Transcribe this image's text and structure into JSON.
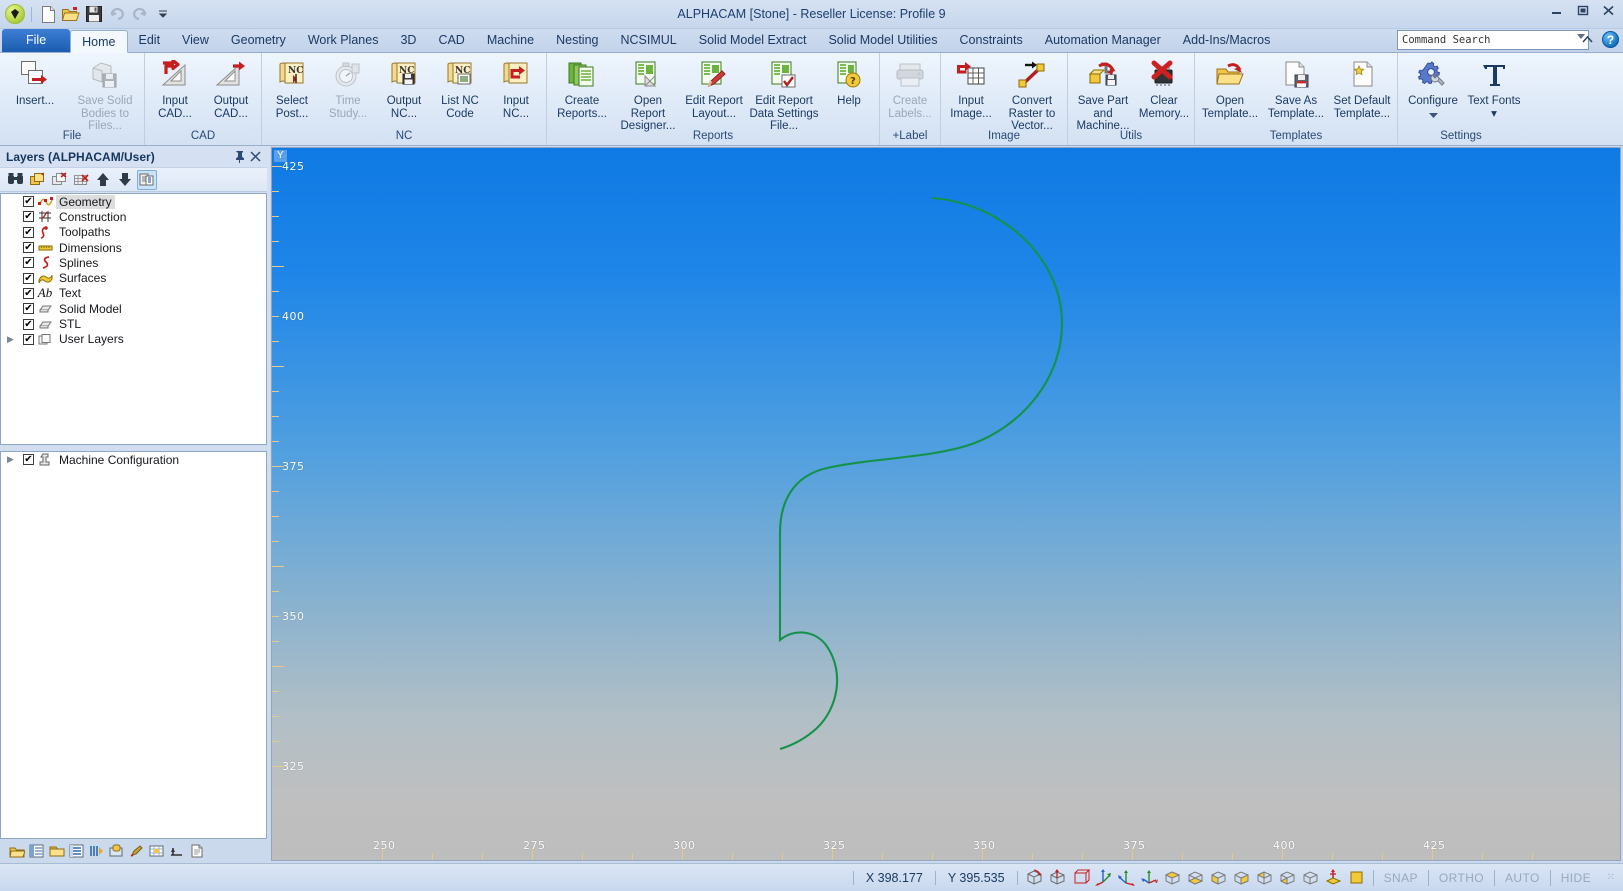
{
  "window": {
    "title": "ALPHACAM [Stone] - Reseller License: Profile 9",
    "minimize": "–",
    "maximize": "□",
    "close": "✕"
  },
  "quick_access": [
    {
      "name": "app-orb",
      "label": "ALPHACAM"
    },
    {
      "name": "new-file-icon",
      "label": "New"
    },
    {
      "name": "open-file-icon",
      "label": "Open"
    },
    {
      "name": "save-icon",
      "label": "Save"
    },
    {
      "name": "undo-icon",
      "label": "Undo"
    },
    {
      "name": "redo-icon",
      "label": "Redo"
    },
    {
      "name": "customize-qat-icon",
      "label": "Customize Quick Access Toolbar"
    }
  ],
  "tabs": [
    {
      "label": "File",
      "active": false,
      "kind": "file"
    },
    {
      "label": "Home",
      "active": true
    },
    {
      "label": "Edit",
      "active": false
    },
    {
      "label": "View",
      "active": false
    },
    {
      "label": "Geometry",
      "active": false
    },
    {
      "label": "Work Planes",
      "active": false
    },
    {
      "label": "3D",
      "active": false
    },
    {
      "label": "CAD",
      "active": false
    },
    {
      "label": "Machine",
      "active": false
    },
    {
      "label": "Nesting",
      "active": false
    },
    {
      "label": "NCSIMUL",
      "active": false
    },
    {
      "label": "Solid Model Extract",
      "active": false
    },
    {
      "label": "Solid Model Utilities",
      "active": false
    },
    {
      "label": "Constraints",
      "active": false
    },
    {
      "label": "Automation Manager",
      "active": false
    },
    {
      "label": "Add-Ins/Macros",
      "active": false
    }
  ],
  "command_search": {
    "placeholder": "Command Search",
    "value": "Command Search"
  },
  "ribbon": {
    "groups": [
      {
        "title": "File",
        "items": [
          {
            "label": "Insert...",
            "icon": "insert-icon",
            "disabled": false,
            "width": "w66"
          },
          {
            "label": "Save Solid Bodies to Files...",
            "icon": "save-solid-bodies-icon",
            "disabled": true,
            "width": "wide"
          }
        ]
      },
      {
        "title": "CAD",
        "items": [
          {
            "label": "Input CAD...",
            "icon": "input-cad-icon",
            "disabled": false
          },
          {
            "label": "Output CAD...",
            "icon": "output-cad-icon",
            "disabled": false
          }
        ]
      },
      {
        "title": "NC",
        "items": [
          {
            "label": "Select Post...",
            "icon": "select-post-icon",
            "disabled": false
          },
          {
            "label": "Time Study...",
            "icon": "time-study-icon",
            "disabled": true
          },
          {
            "label": "Output NC...",
            "icon": "output-nc-icon",
            "disabled": false
          },
          {
            "label": "List NC Code",
            "icon": "list-nc-code-icon",
            "disabled": false
          },
          {
            "label": "Input NC...",
            "icon": "input-nc-icon",
            "disabled": false
          }
        ]
      },
      {
        "title": "Reports",
        "items": [
          {
            "label": "Create Reports...",
            "icon": "create-reports-icon",
            "disabled": false,
            "width": "w66"
          },
          {
            "label": "Open Report Designer...",
            "icon": "open-report-designer-icon",
            "disabled": false,
            "width": "w66"
          },
          {
            "label": "Edit Report Layout...",
            "icon": "edit-report-layout-icon",
            "disabled": false,
            "width": "w66"
          },
          {
            "label": "Edit Report Data Settings File...",
            "icon": "edit-report-data-settings-icon",
            "disabled": false,
            "width": "wide"
          },
          {
            "label": "Help",
            "icon": "help-report-icon",
            "disabled": false,
            "width": "w40"
          }
        ]
      },
      {
        "title": "+Label",
        "items": [
          {
            "label": "Create Labels...",
            "icon": "create-labels-icon",
            "disabled": true
          }
        ]
      },
      {
        "title": "Image",
        "items": [
          {
            "label": "Input Image...",
            "icon": "input-image-icon",
            "disabled": false
          },
          {
            "label": "Convert Raster to Vector...",
            "icon": "convert-raster-to-vector-icon",
            "disabled": false,
            "width": "w66"
          }
        ]
      },
      {
        "title": "Utils",
        "items": [
          {
            "label": "Save Part and Machine...",
            "icon": "save-part-machine-icon",
            "disabled": false,
            "width": "w66"
          },
          {
            "label": "Clear Memory...",
            "icon": "clear-memory-icon",
            "disabled": false
          }
        ]
      },
      {
        "title": "Templates",
        "items": [
          {
            "label": "Open Template...",
            "icon": "open-template-icon",
            "disabled": false,
            "width": "w66"
          },
          {
            "label": "Save As Template...",
            "icon": "save-as-template-icon",
            "disabled": false,
            "width": "w66"
          },
          {
            "label": "Set Default Template...",
            "icon": "set-default-template-icon",
            "disabled": false,
            "width": "w66"
          }
        ]
      },
      {
        "title": "Settings",
        "items": [
          {
            "label": "Configure",
            "icon": "configure-icon",
            "disabled": false,
            "width": "w66",
            "dropdown": true
          },
          {
            "label": "Text Fonts",
            "icon": "text-fonts-icon",
            "disabled": false,
            "dropdown_inline": true
          }
        ]
      }
    ]
  },
  "layers_panel": {
    "title": "Layers (ALPHACAM/User)",
    "pin": "⊞",
    "close": "✕",
    "toolbar": [
      {
        "name": "find-layer-icon",
        "selected": false
      },
      {
        "name": "new-layer-icon",
        "selected": false
      },
      {
        "name": "delete-layer-icon",
        "selected": false
      },
      {
        "name": "delete-all-layers-icon",
        "selected": false
      },
      {
        "name": "move-layer-up-icon",
        "selected": false
      },
      {
        "name": "move-layer-down-icon",
        "selected": false
      },
      {
        "name": "layer-properties-icon",
        "selected": true
      }
    ],
    "items": [
      {
        "label": "Geometry",
        "checked": true,
        "icon": "geometry-icon",
        "selected": true,
        "expandable": false
      },
      {
        "label": "Construction",
        "checked": true,
        "icon": "construction-icon",
        "selected": false,
        "expandable": false
      },
      {
        "label": "Toolpaths",
        "checked": true,
        "icon": "toolpaths-icon",
        "selected": false,
        "expandable": false
      },
      {
        "label": "Dimensions",
        "checked": true,
        "icon": "dimensions-icon",
        "selected": false,
        "expandable": false
      },
      {
        "label": "Splines",
        "checked": true,
        "icon": "splines-icon",
        "selected": false,
        "expandable": false
      },
      {
        "label": "Surfaces",
        "checked": true,
        "icon": "surfaces-icon",
        "selected": false,
        "expandable": false
      },
      {
        "label": "Text",
        "checked": true,
        "icon": "text-icon",
        "selected": false,
        "expandable": false
      },
      {
        "label": "Solid Model",
        "checked": true,
        "icon": "solid-model-icon",
        "selected": false,
        "expandable": false
      },
      {
        "label": "STL",
        "checked": true,
        "icon": "stl-icon",
        "selected": false,
        "expandable": false
      },
      {
        "label": "User Layers",
        "checked": true,
        "icon": "user-layers-icon",
        "selected": false,
        "expandable": true
      }
    ],
    "machine_tree": [
      {
        "label": "Machine Configuration",
        "checked": true,
        "icon": "machine-config-icon",
        "expandable": true
      }
    ],
    "bottom_icons": [
      {
        "name": "layers-tab-icon"
      },
      {
        "name": "tool-list-tab-icon"
      },
      {
        "name": "project-manager-tab-icon"
      },
      {
        "name": "operations-tab-icon"
      },
      {
        "name": "toolpath-order-tab-icon"
      },
      {
        "name": "material-tab-icon"
      },
      {
        "name": "styles-tab-icon"
      },
      {
        "name": "work-planes-tab-icon"
      },
      {
        "name": "constraints-tab-icon"
      },
      {
        "name": "notes-tab-icon"
      }
    ]
  },
  "canvas": {
    "axis_corner_label": "Y",
    "y_ticks": [
      {
        "value": "425",
        "major": true
      },
      {
        "value": "400",
        "major": true
      },
      {
        "value": "375",
        "major": true
      },
      {
        "value": "350",
        "major": true
      },
      {
        "value": "325",
        "major": true
      }
    ],
    "x_ticks": [
      {
        "value": "250"
      },
      {
        "value": "275"
      },
      {
        "value": "300"
      },
      {
        "value": "325"
      },
      {
        "value": "350"
      },
      {
        "value": "375"
      },
      {
        "value": "400"
      },
      {
        "value": "425"
      }
    ],
    "geometry_color": "#14924a",
    "background_top": "#0f7ae4",
    "background_bottom": "#bdbdbd"
  },
  "status_bar": {
    "x_coord": "X 398.177",
    "y_coord": "Y 395.535",
    "view_icons": [
      {
        "name": "iso-view-icon"
      },
      {
        "name": "axonometric-view-icon"
      },
      {
        "name": "plan-view-icon"
      },
      {
        "name": "xy-axes-icon"
      },
      {
        "name": "yz-axes-icon"
      },
      {
        "name": "zx-axes-icon"
      },
      {
        "name": "top-face-icon"
      },
      {
        "name": "bottom-face-icon"
      },
      {
        "name": "front-face-icon"
      },
      {
        "name": "back-face-icon"
      },
      {
        "name": "left-face-icon"
      },
      {
        "name": "right-face-icon"
      },
      {
        "name": "iso-face-icon"
      },
      {
        "name": "work-plane-origin-icon"
      },
      {
        "name": "colour-swatch-icon"
      }
    ],
    "toggles": [
      {
        "label": "SNAP",
        "active": false
      },
      {
        "label": "ORTHO",
        "active": false
      },
      {
        "label": "AUTO",
        "active": false
      },
      {
        "label": "HIDE",
        "active": false
      }
    ],
    "grip": "⁙"
  }
}
